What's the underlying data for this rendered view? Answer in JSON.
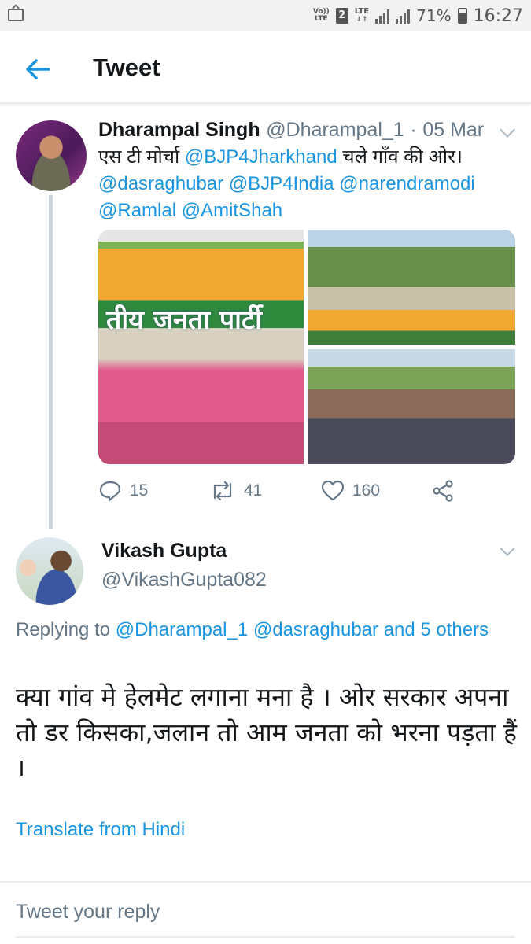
{
  "status_bar": {
    "volte_top": "Vo))",
    "volte_bottom": "LTE",
    "sim_number": "2",
    "network": "LTE",
    "battery_percent": "71%",
    "time": "16:27",
    "notification_icon": "gmail-icon"
  },
  "header": {
    "back_icon": "arrow-left-icon",
    "title": "Tweet"
  },
  "tweet": {
    "author_name": "Dharampal Singh",
    "author_handle": "@Dharampal_1",
    "separator": "·",
    "date": "05 Mar",
    "text_part1": "एस टी मोर्चा ",
    "mention1": "@BJP4Jharkhand",
    "text_part2": " चले गाँव की ओर।",
    "mention2": "@dasraghubar",
    "mention3": "@BJP4India",
    "mention4": "@narendramodi",
    "mention5": "@Ramlal",
    "mention6": "@AmitShah",
    "photo_sign_text": "तीय जनता पार्टी",
    "reply_count": "15",
    "retweet_count": "41",
    "like_count": "160",
    "link_color": "#1b95e0"
  },
  "reply": {
    "author_name": "Vikash Gupta",
    "author_handle": "@VikashGupta082",
    "replying_prefix": "Replying to ",
    "replying_to_1": "@Dharampal_1",
    "replying_to_2": "@dasraghubar",
    "replying_and_others": "and 5 others",
    "text": "क्या गांव मे हेलमेट लगाना मना है । ओर सरकार अपना तो डर किसका,जलान तो आम जनता को भरना पड़ता हैं ।",
    "translate_label": "Translate from Hindi"
  },
  "compose": {
    "placeholder": "Tweet your reply"
  }
}
